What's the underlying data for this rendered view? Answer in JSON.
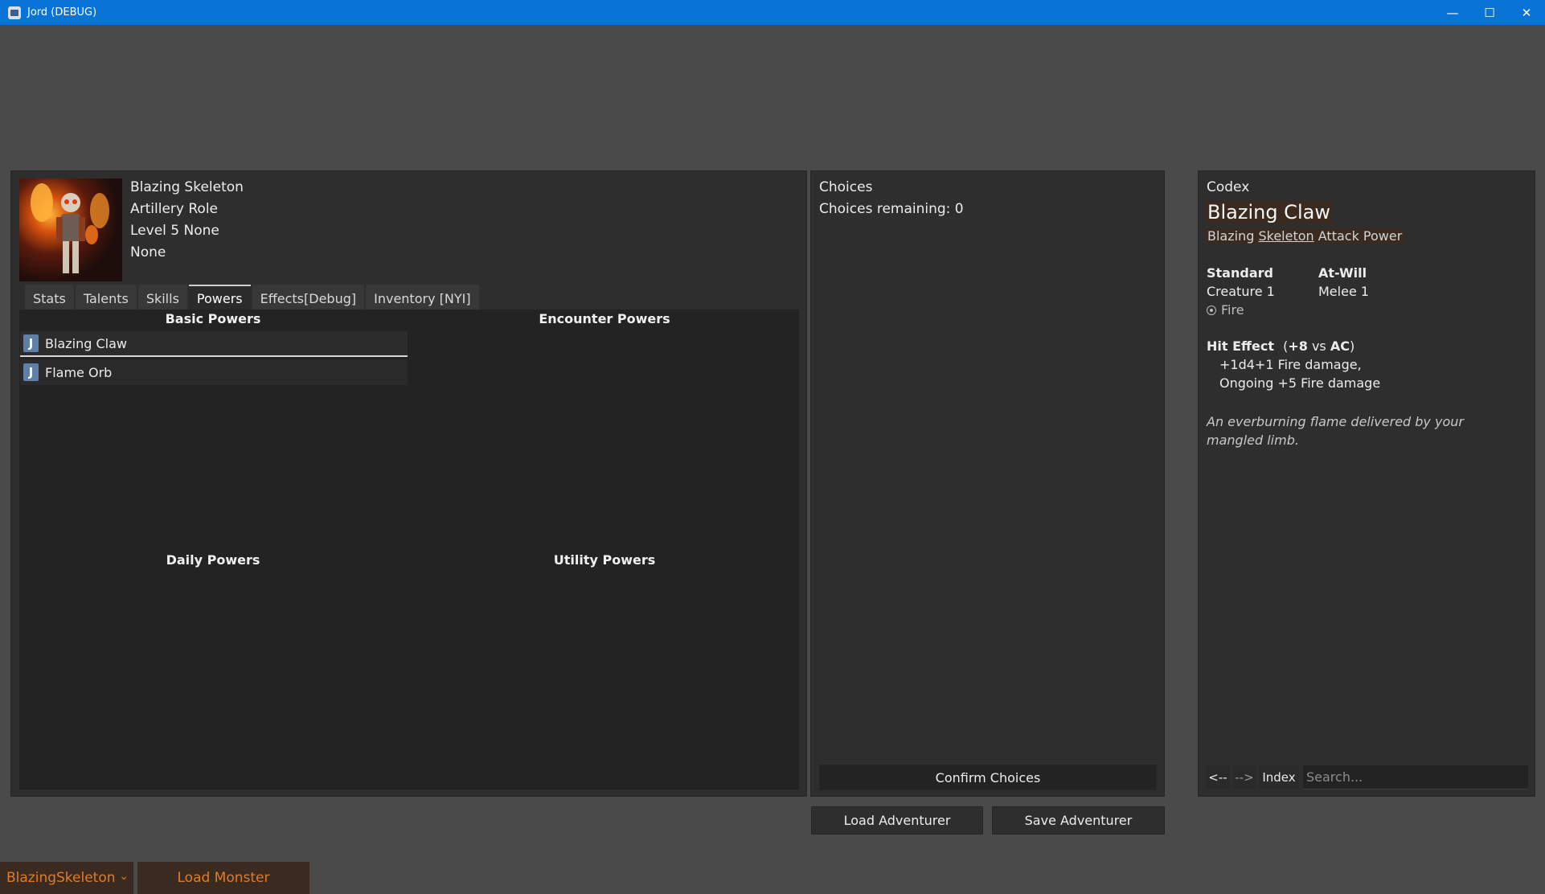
{
  "window": {
    "title": "Jord (DEBUG)",
    "minimize_glyph": "—",
    "maximize_glyph": "☐",
    "close_glyph": "✕"
  },
  "character": {
    "name": "Blazing Skeleton",
    "role": "Artillery Role",
    "level": "Level 5 None",
    "extra": "None"
  },
  "tabs": [
    {
      "label": "Stats"
    },
    {
      "label": "Talents"
    },
    {
      "label": "Skills"
    },
    {
      "label": "Powers"
    },
    {
      "label": "Effects[Debug]"
    },
    {
      "label": "Inventory [NYI]"
    }
  ],
  "powers": {
    "basic_title": "Basic Powers",
    "encounter_title": "Encounter Powers",
    "daily_title": "Daily Powers",
    "utility_title": "Utility Powers",
    "icon_letter": "J",
    "basic": [
      {
        "name": "Blazing Claw"
      },
      {
        "name": "Flame Orb"
      }
    ]
  },
  "choices": {
    "title": "Choices",
    "remaining": "Choices remaining: 0",
    "confirm_label": "Confirm Choices"
  },
  "codex": {
    "title": "Codex",
    "power_name": "Blazing Claw",
    "subtitle_prefix": "Blazing",
    "subtitle_link": "Skeleton",
    "subtitle_suffix": "Attack Power",
    "action_type": "Standard",
    "usage": "At-Will",
    "target": "Creature 1",
    "range": "Melee 1",
    "keyword": "Fire",
    "hit_label": "Hit Effect",
    "hit_open": "(",
    "hit_bonus": "+8",
    "hit_vs": "vs",
    "hit_defense": "AC",
    "hit_close": ")",
    "hit_line1": "+1d4+1 Fire damage,",
    "hit_line2": "Ongoing +5 Fire damage",
    "flavor": "An everburning flame delivered by your mangled limb.",
    "back_label": "<--",
    "forward_label": "-->",
    "index_label": "Index",
    "search_placeholder": "Search..."
  },
  "bottom": {
    "load_adventurer": "Load Adventurer",
    "save_adventurer": "Save Adventurer",
    "monster_select": "BlazingSkeleton",
    "load_monster": "Load Monster"
  },
  "colors": {
    "accent_orange": "#e07b2a",
    "titlebar_blue": "#0a74d6"
  }
}
